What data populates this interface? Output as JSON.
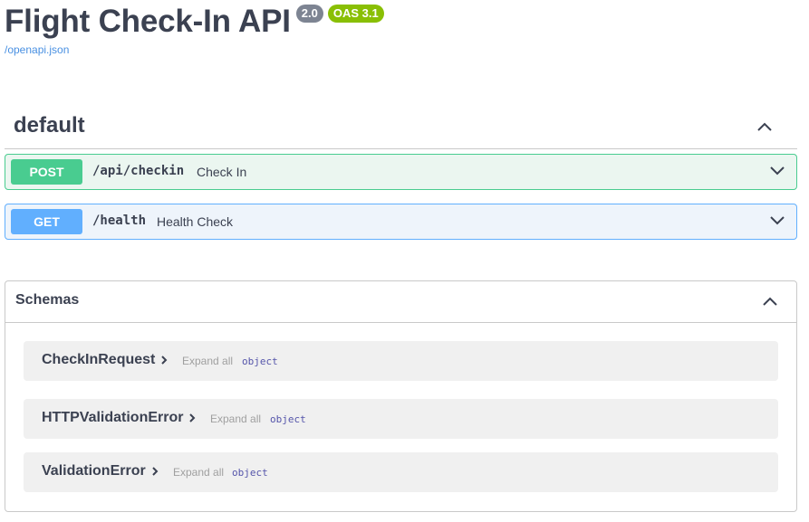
{
  "header": {
    "title": "Flight Check-In API",
    "version_badge": "2.0",
    "oas_badge": "OAS 3.1",
    "spec_link": "/openapi.json"
  },
  "tag": {
    "name": "default",
    "operations": [
      {
        "method": "POST",
        "path": "/api/checkin",
        "summary": "Check In"
      },
      {
        "method": "GET",
        "path": "/health",
        "summary": "Health Check"
      }
    ]
  },
  "schemas": {
    "title": "Schemas",
    "models": [
      {
        "name": "CheckInRequest",
        "expand_label": "Expand all",
        "type": "object"
      },
      {
        "name": "HTTPValidationError",
        "expand_label": "Expand all",
        "type": "object"
      },
      {
        "name": "ValidationError",
        "expand_label": "Expand all",
        "type": "object"
      }
    ]
  },
  "colors": {
    "post": "#49cc90",
    "get": "#61affe",
    "version_badge": "#7d8492",
    "oas_badge": "#89bf04",
    "link": "#4990e2"
  },
  "icons": {
    "collapse": "chevron-up-icon",
    "expand": "chevron-down-icon",
    "model_expand": "chevron-right-icon"
  }
}
